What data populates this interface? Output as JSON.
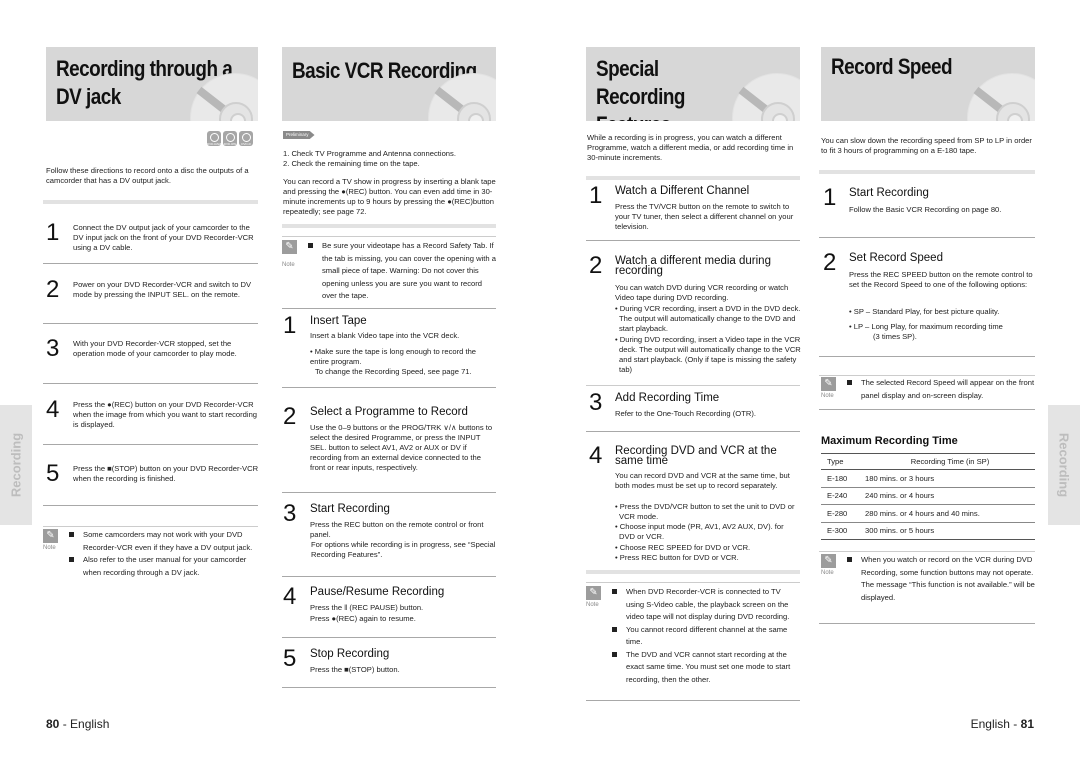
{
  "pages": {
    "left_page_number": "80",
    "right_page_number": "81",
    "language": "English",
    "side_tab": "Recording"
  },
  "dv_jack": {
    "title": "Recording through a DV jack",
    "disc_badges": [
      "DVD-RAM",
      "DVD-RW",
      "DVD-R"
    ],
    "intro": "Follow these directions to record onto a disc the outputs of a camcorder that has a DV output jack.",
    "steps": [
      {
        "num": "1",
        "text": "Connect the DV output jack of your camcorder to the DV input jack on the front of your DVD Recorder-VCR using a DV cable."
      },
      {
        "num": "2",
        "text": "Power on your DVD Recorder-VCR and switch to DV mode by pressing the INPUT SEL. on the remote."
      },
      {
        "num": "3",
        "text": "With your DVD Recorder-VCR stopped, set the operation mode of your camcorder to play mode."
      },
      {
        "num": "4",
        "text": "Press the ●(REC) button on your DVD Recorder-VCR when the image from which you want to start recording is displayed."
      },
      {
        "num": "5",
        "text": "Press the ■(STOP) button on your DVD Recorder-VCR when the recording is finished."
      }
    ],
    "note_label": "Note",
    "notes": [
      "Some camcorders may not work with your DVD Recorder-VCR even if they have a DV output jack.",
      "Also refer to the user manual for your camcorder when recording through a DV jack."
    ]
  },
  "basic_vcr": {
    "title": "Basic VCR Recording",
    "preliminary_label": "Preliminary",
    "prelim_lines": [
      "1. Check TV Programme and Antenna connections.",
      "2. Check the remaining time on the tape."
    ],
    "intro": "You can record a TV show in progress by inserting a blank tape and pressing the ●(REC) button. You can even add time in 30-minute increments up to 9 hours by pressing the ●(REC)button repeatedly; see page 72.",
    "note_label": "Note",
    "note": "Be sure your videotape has a Record Safety Tab. If the tab is missing, you can cover the opening with a small piece of tape. Warning: Do not cover this opening unless you are sure you want to record over the tape.",
    "steps": [
      {
        "num": "1",
        "title": "Insert Tape",
        "text": "Insert a blank Video tape into the VCR deck.",
        "extra": "• Make sure the tape is long enough to record the entire program.",
        "extra2": "To change the Recording Speed, see page 71."
      },
      {
        "num": "2",
        "title": "Select a Programme to Record",
        "text": "Use the 0–9 buttons or the PROG/TRK ∨/∧ buttons to select the desired Programme, or press the INPUT SEL. button to select AV1, AV2 or AUX or DV if recording from an external device connected to the front or rear inputs, respectively."
      },
      {
        "num": "3",
        "title": "Start Recording",
        "text": "Press the REC button on the remote control or front panel.",
        "extra": "For options while recording is in progress, see “Special Recording Features”."
      },
      {
        "num": "4",
        "title": "Pause/Resume Recording",
        "text": "Press the ‖ (REC PAUSE) button.",
        "extra": "Press ●(REC) again to resume."
      },
      {
        "num": "5",
        "title": "Stop Recording",
        "text": "Press the ■(STOP) button."
      }
    ]
  },
  "special": {
    "title": "Special Recording Features",
    "intro": "While a recording is in progress, you can watch a different Programme, watch a different media, or add recording time in 30-minute increments.",
    "steps": [
      {
        "num": "1",
        "title": "Watch a Different Channel",
        "text": "Press the TV/VCR button on the remote to switch to your TV tuner, then select a different channel on your television."
      },
      {
        "num": "2",
        "title": "Watch a different media during recording",
        "text": "You can watch DVD during VCR recording or watch Video tape during DVD recording.",
        "bullets": [
          "• During VCR recording, insert a DVD in the DVD deck. The output will automatically change to the DVD and start playback.",
          "• During DVD recording, insert a Video tape in the VCR deck. The output will automatically change to the VCR and start playback. (Only if tape is missing the safety tab)"
        ]
      },
      {
        "num": "3",
        "title": "Add Recording Time",
        "text": "Refer to the One-Touch Recording (OTR)."
      },
      {
        "num": "4",
        "title": "Recording DVD and VCR at the same time",
        "text": "You can record DVD and VCR at the same time, but both modes must be set up to record separately.",
        "bullets": [
          "• Press the DVD/VCR button to set the unit to DVD or VCR mode.",
          "• Choose input mode (PR, AV1, AV2 AUX, DV). for DVD or VCR.",
          "• Choose REC SPEED for DVD or VCR.",
          "• Press REC button for DVD or VCR."
        ]
      }
    ],
    "note_label": "Note",
    "notes": [
      "When DVD Recorder-VCR is connected to TV using S-Video cable, the playback screen on the video tape will not display during DVD recording.",
      "You cannot record different channel at the same time.",
      "The DVD and VCR cannot start recording at the exact same time. You must set one mode to start recording, then the other."
    ]
  },
  "record_speed": {
    "title": "Record Speed",
    "intro": "You can slow down the recording speed from SP to LP in order to fit 3 hours of programming on a E-180 tape.",
    "steps": [
      {
        "num": "1",
        "title": "Start Recording",
        "text": "Follow the Basic VCR Recording on page 80."
      },
      {
        "num": "2",
        "title": "Set Record Speed",
        "text": "Press the REC SPEED button on the remote control to set the Record Speed to one of the following options:",
        "bullets": [
          "• SP – Standard Play, for best picture quality.",
          "• LP – Long Play, for maximum recording time (3 times SP)."
        ]
      }
    ],
    "note_label": "Note",
    "note": "The selected Record Speed will appear on the front panel display and on-screen display.",
    "table_title": "Maximum Recording Time",
    "table_headers": [
      "Type",
      "Recording Time (in SP)"
    ],
    "table_rows": [
      [
        "E-180",
        "180 mins. or 3 hours"
      ],
      [
        "E-240",
        "240 mins. or 4 hours"
      ],
      [
        "E-280",
        "280 mins. or 4 hours and 40 mins."
      ],
      [
        "E-300",
        "300 mins. or 5 hours"
      ]
    ],
    "note2": "When you watch or record on the VCR during DVD Recording, some function buttons may not operate.",
    "note2_extra": "The message “This function is not available.” will be displayed."
  }
}
